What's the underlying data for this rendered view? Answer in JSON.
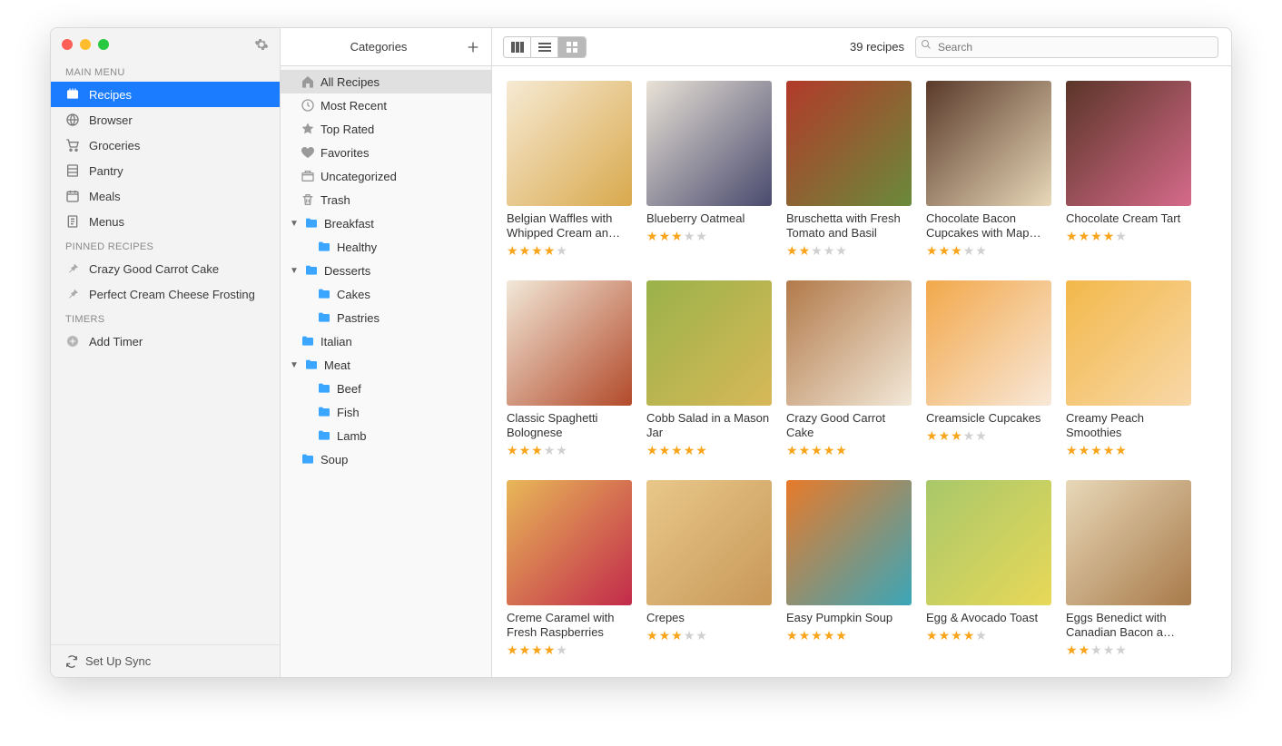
{
  "sidebar": {
    "sections": [
      {
        "header": "MAIN MENU",
        "items": [
          {
            "icon": "recipes",
            "label": "Recipes",
            "selected": true
          },
          {
            "icon": "browser",
            "label": "Browser"
          },
          {
            "icon": "groceries",
            "label": "Groceries"
          },
          {
            "icon": "pantry",
            "label": "Pantry"
          },
          {
            "icon": "meals",
            "label": "Meals"
          },
          {
            "icon": "menus",
            "label": "Menus"
          }
        ]
      },
      {
        "header": "PINNED RECIPES",
        "items": [
          {
            "icon": "pin",
            "label": "Crazy Good Carrot Cake"
          },
          {
            "icon": "pin",
            "label": "Perfect Cream Cheese Frosting"
          }
        ]
      },
      {
        "header": "TIMERS",
        "items": [
          {
            "icon": "plus-circle",
            "label": "Add Timer"
          }
        ]
      }
    ],
    "sync": "Set Up Sync"
  },
  "categories": {
    "title": "Categories",
    "items": [
      {
        "indent": 0,
        "icon": "home",
        "label": "All Recipes",
        "selected": true
      },
      {
        "indent": 0,
        "icon": "clock",
        "label": "Most Recent"
      },
      {
        "indent": 0,
        "icon": "star",
        "label": "Top Rated"
      },
      {
        "indent": 0,
        "icon": "heart",
        "label": "Favorites"
      },
      {
        "indent": 0,
        "icon": "box",
        "label": "Uncategorized"
      },
      {
        "indent": 0,
        "icon": "trash",
        "label": "Trash"
      },
      {
        "indent": 0,
        "icon": "folder",
        "label": "Breakfast",
        "disclosure": "down"
      },
      {
        "indent": 1,
        "icon": "folder",
        "label": "Healthy"
      },
      {
        "indent": 0,
        "icon": "folder",
        "label": "Desserts",
        "disclosure": "down"
      },
      {
        "indent": 1,
        "icon": "folder",
        "label": "Cakes"
      },
      {
        "indent": 1,
        "icon": "folder",
        "label": "Pastries"
      },
      {
        "indent": 0,
        "icon": "folder",
        "label": "Italian"
      },
      {
        "indent": 0,
        "icon": "folder",
        "label": "Meat",
        "disclosure": "down"
      },
      {
        "indent": 1,
        "icon": "folder",
        "label": "Beef"
      },
      {
        "indent": 1,
        "icon": "folder",
        "label": "Fish"
      },
      {
        "indent": 1,
        "icon": "folder",
        "label": "Lamb"
      },
      {
        "indent": 0,
        "icon": "folder",
        "label": "Soup"
      }
    ]
  },
  "main": {
    "count_label": "39 recipes",
    "search_placeholder": "Search",
    "recipes": [
      {
        "title": "Belgian Waffles with Whipped Cream an…",
        "rating": 4,
        "bg": "linear-gradient(135deg,#f6ead3,#d9a94d)"
      },
      {
        "title": "Blueberry Oatmeal",
        "rating": 3,
        "bg": "linear-gradient(135deg,#e8e2d6,#4a4a6e)"
      },
      {
        "title": "Bruschetta with Fresh Tomato and Basil",
        "rating": 2,
        "bg": "linear-gradient(135deg,#b23a2a,#6a8a3a)"
      },
      {
        "title": "Chocolate Bacon Cupcakes with Map…",
        "rating": 3,
        "bg": "linear-gradient(135deg,#5a3a2a,#e8d8b8)"
      },
      {
        "title": "Chocolate Cream Tart",
        "rating": 4,
        "bg": "linear-gradient(135deg,#5a3528,#d66a8a)"
      },
      {
        "title": "Classic Spaghetti Bolognese",
        "rating": 3,
        "bg": "linear-gradient(135deg,#f2e8d8,#b24a2a)"
      },
      {
        "title": "Cobb Salad in a Mason Jar",
        "rating": 5,
        "bg": "linear-gradient(135deg,#9ab24a,#d8b858)"
      },
      {
        "title": "Crazy Good Carrot Cake",
        "rating": 5,
        "bg": "linear-gradient(135deg,#b27a4a,#f2e8d8)"
      },
      {
        "title": "Creamsicle Cupcakes",
        "rating": 3,
        "bg": "linear-gradient(135deg,#f2a84a,#f8e8d8)"
      },
      {
        "title": "Creamy Peach Smoothies",
        "rating": 5,
        "bg": "linear-gradient(135deg,#f2b84a,#f8d8a8)"
      },
      {
        "title": "Creme Caramel with Fresh Raspberries",
        "rating": 4,
        "bg": "linear-gradient(135deg,#e8b858,#c22a4a)"
      },
      {
        "title": "Crepes",
        "rating": 3,
        "bg": "linear-gradient(135deg,#e8c88a,#c89858)"
      },
      {
        "title": "Easy Pumpkin Soup",
        "rating": 5,
        "bg": "linear-gradient(135deg,#e87a2a,#3aa6b8)"
      },
      {
        "title": "Egg & Avocado Toast",
        "rating": 4,
        "bg": "linear-gradient(135deg,#a8c86a,#e8d858)"
      },
      {
        "title": "Eggs Benedict with Canadian Bacon a…",
        "rating": 2,
        "bg": "linear-gradient(135deg,#e8d8b8,#a87a4a)"
      }
    ]
  }
}
